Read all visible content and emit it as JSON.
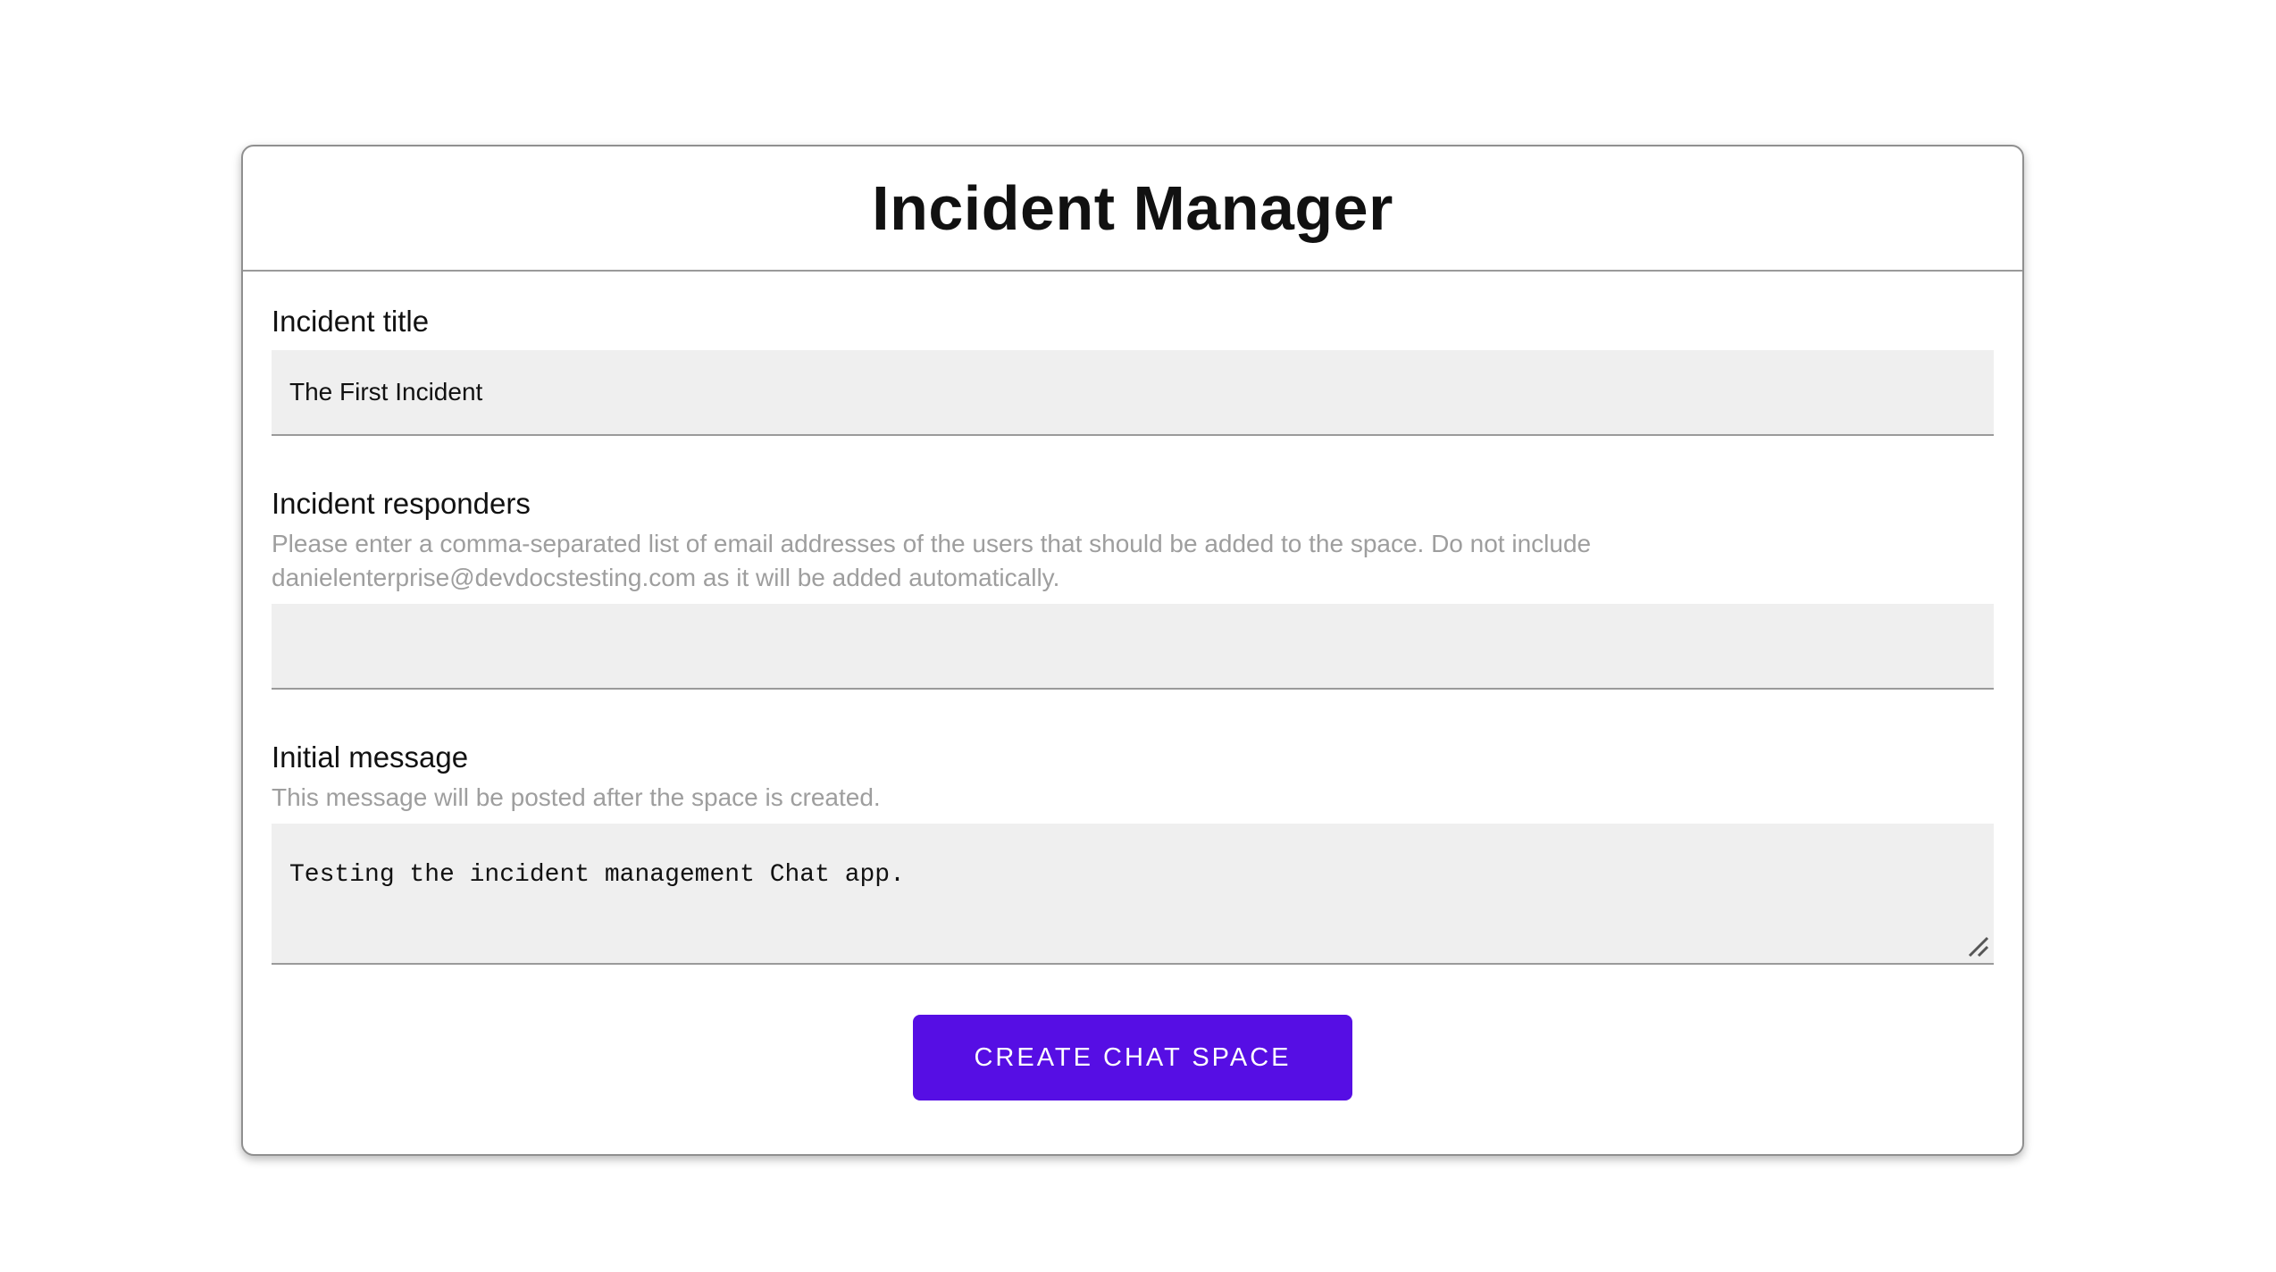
{
  "header": {
    "title": "Incident Manager"
  },
  "form": {
    "incident_title": {
      "label": "Incident title",
      "value": "The First Incident"
    },
    "incident_responders": {
      "label": "Incident responders",
      "hint": "Please enter a comma-separated list of email addresses of the users that should be added to the space. Do not include danielenterprise@devdocstesting.com as it will be added automatically.",
      "value": ""
    },
    "initial_message": {
      "label": "Initial message",
      "hint": "This message will be posted after the space is created.",
      "value": "Testing the incident management Chat app."
    }
  },
  "actions": {
    "create_chat_space": "CREATE CHAT SPACE"
  },
  "colors": {
    "primary_button": "#560ee4",
    "field_background": "#efefef",
    "hint_text": "#9e9e9e",
    "card_border": "#8f8f8f"
  }
}
